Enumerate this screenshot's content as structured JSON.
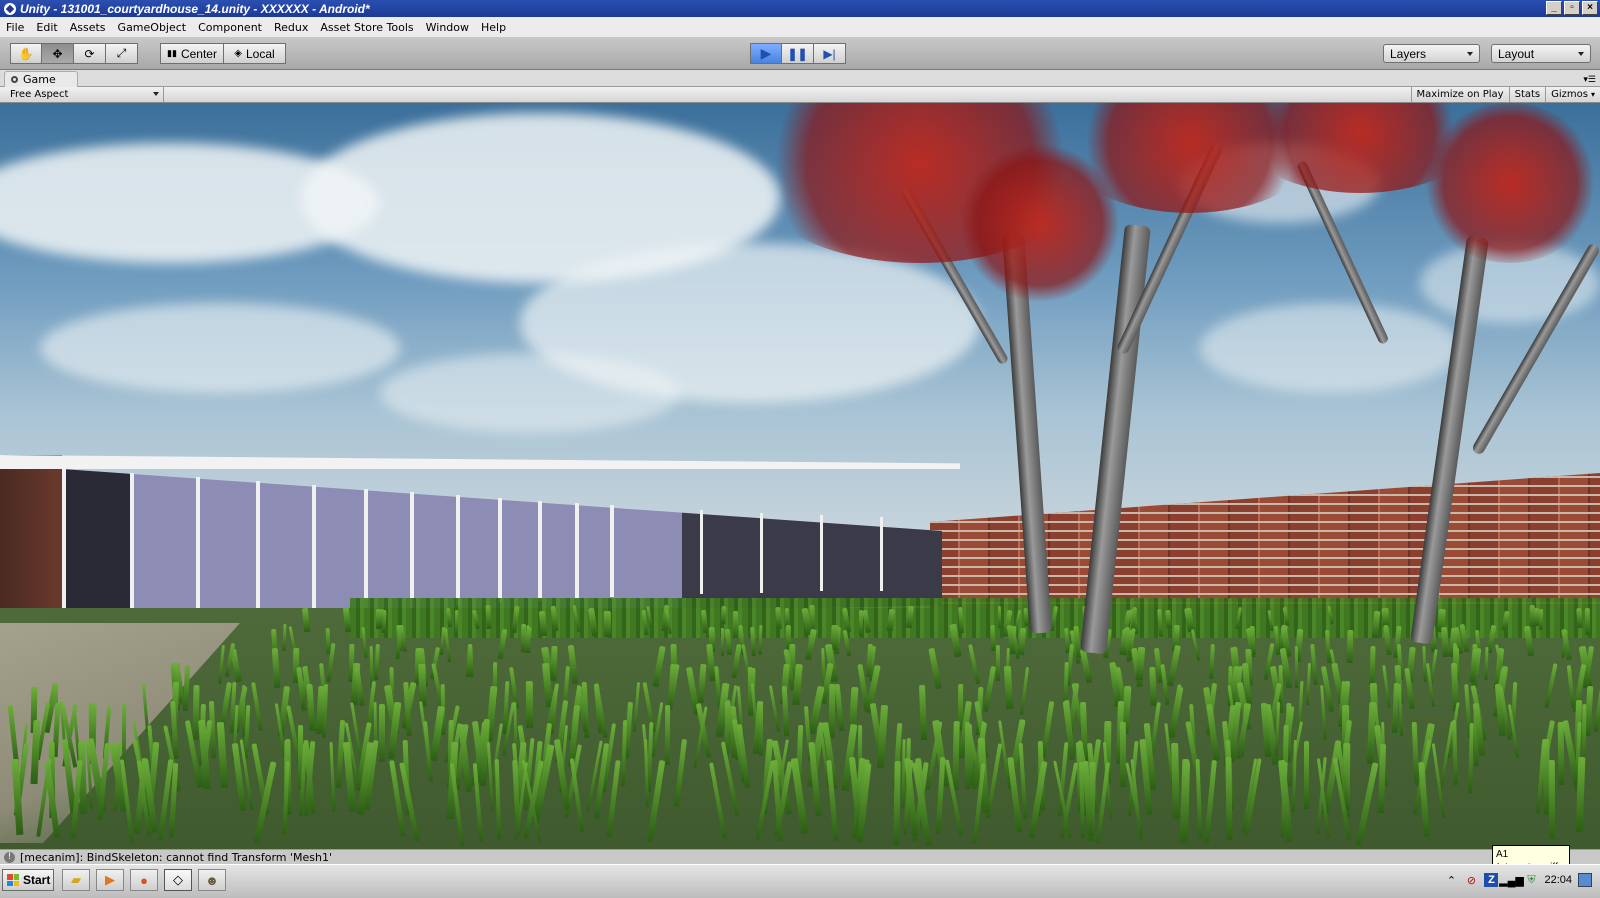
{
  "window": {
    "title": "Unity - 131001_courtyardhouse_14.unity - XXXXXX - Android*"
  },
  "menu": [
    "File",
    "Edit",
    "Assets",
    "GameObject",
    "Component",
    "Redux",
    "Asset Store Tools",
    "Window",
    "Help"
  ],
  "toolbar": {
    "tools": [
      "hand-icon",
      "move-icon",
      "rotate-icon",
      "scale-icon"
    ],
    "pivot_label": "Center",
    "space_label": "Local",
    "layers_label": "Layers",
    "layout_label": "Layout"
  },
  "game_panel": {
    "tab_label": "Game",
    "aspect": "Free Aspect",
    "maximize_label": "Maximize on Play",
    "stats_label": "Stats",
    "gizmos_label": "Gizmos"
  },
  "status": {
    "message": "[mecanim]: BindSkeleton: cannot find Transform 'Mesh1'"
  },
  "taskbar": {
    "start_label": "Start",
    "clock": "22:04",
    "tooltip_line1": "A1",
    "tooltip_line2": "Internetzugriff"
  },
  "colors": {
    "play_active": "#4a82e0",
    "title_bar": "#1c3a96"
  }
}
